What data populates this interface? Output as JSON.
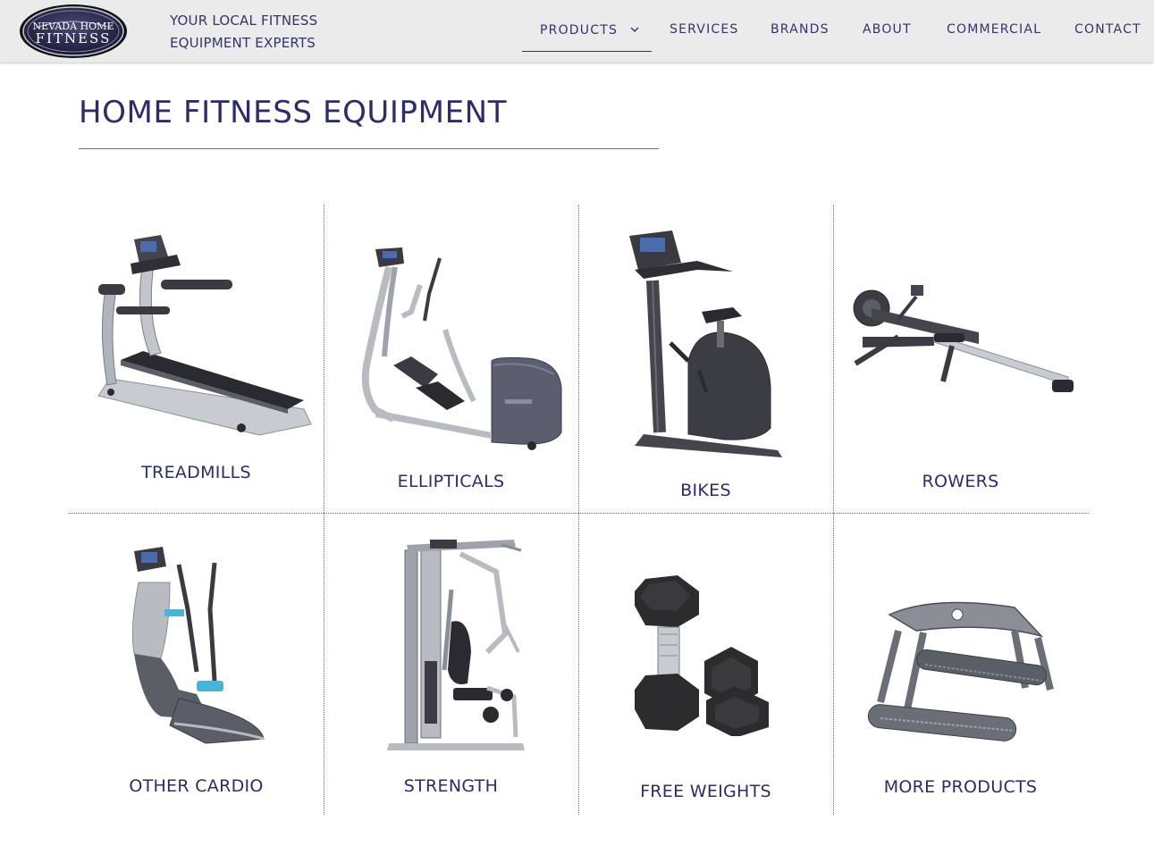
{
  "header": {
    "logo": {
      "line1": "NEVADA HOME",
      "line2": "FITNESS"
    },
    "tagline": [
      "YOUR LOCAL FITNESS",
      "EQUIPMENT EXPERTS"
    ],
    "nav": {
      "products": "PRODUCTS",
      "services": "SERVICES",
      "brands": "BRANDS",
      "about": "ABOUT",
      "commercial": "COMMERCIAL",
      "contact": "CONTACT"
    },
    "active_nav": "PRODUCTS"
  },
  "main": {
    "title": "HOME FITNESS EQUIPMENT",
    "categories": [
      {
        "label": "TREADMILLS",
        "icon": "treadmill-icon"
      },
      {
        "label": "ELLIPTICALS",
        "icon": "elliptical-icon"
      },
      {
        "label": "BIKES",
        "icon": "bike-icon"
      },
      {
        "label": "ROWERS",
        "icon": "rower-icon"
      },
      {
        "label": "OTHER CARDIO",
        "icon": "adaptive-motion-trainer-icon"
      },
      {
        "label": "STRENGTH",
        "icon": "home-gym-icon"
      },
      {
        "label": "FREE WEIGHTS",
        "icon": "dumbbells-icon"
      },
      {
        "label": "MORE PRODUCTS",
        "icon": "row-handle-icon"
      }
    ]
  },
  "colors": {
    "brand_navy": "#2c2c6a",
    "header_bg": "#ebebeb",
    "equipment_dark": "#3c3c44",
    "equipment_silver": "#b8bcc2"
  }
}
